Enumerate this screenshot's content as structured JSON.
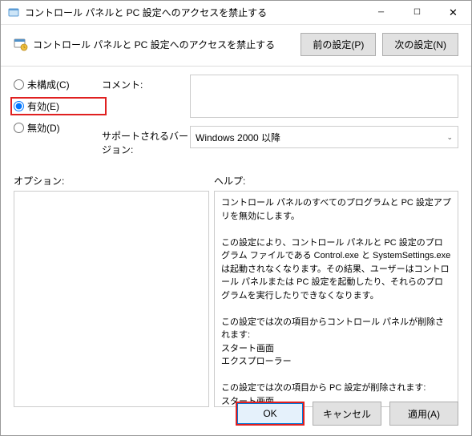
{
  "window": {
    "title": "コントロール パネルと PC 設定へのアクセスを禁止する"
  },
  "header": {
    "title": "コントロール パネルと PC 設定へのアクセスを禁止する",
    "prev": "前の設定(P)",
    "next": "次の設定(N)"
  },
  "radios": {
    "not_configured": "未構成(C)",
    "enabled": "有効(E)",
    "disabled": "無効(D)",
    "selected": "enabled"
  },
  "fields": {
    "comment_label": "コメント:",
    "comment_value": "",
    "supported_label": "サポートされるバージョン:",
    "supported_value": "Windows 2000 以降"
  },
  "section_labels": {
    "options": "オプション:",
    "help": "ヘルプ:"
  },
  "help_text": "コントロール パネルのすべてのプログラムと PC 設定アプリを無効にします。\n\nこの設定により、コントロール パネルと PC 設定のプログラム ファイルである Control.exe と SystemSettings.exe は起動されなくなります。その結果、ユーザーはコントロール パネルまたは PC 設定を起動したり、それらのプログラムを実行したりできなくなります。\n\nこの設定では次の項目からコントロール パネルが削除されます:\nスタート画面\nエクスプローラー\n\nこの設定では次の項目から PC 設定が削除されます:\nスタート画面\n設定チャーム\nアカウントの画像\n検索結果\n\nユーザーがショートカット メニューのプロパティ項目からコントロール パネルのプログラムを開始しようとすると、設定によって禁止されているという内容のメッセージが表示されます。",
  "buttons": {
    "ok": "OK",
    "cancel": "キャンセル",
    "apply": "適用(A)"
  }
}
